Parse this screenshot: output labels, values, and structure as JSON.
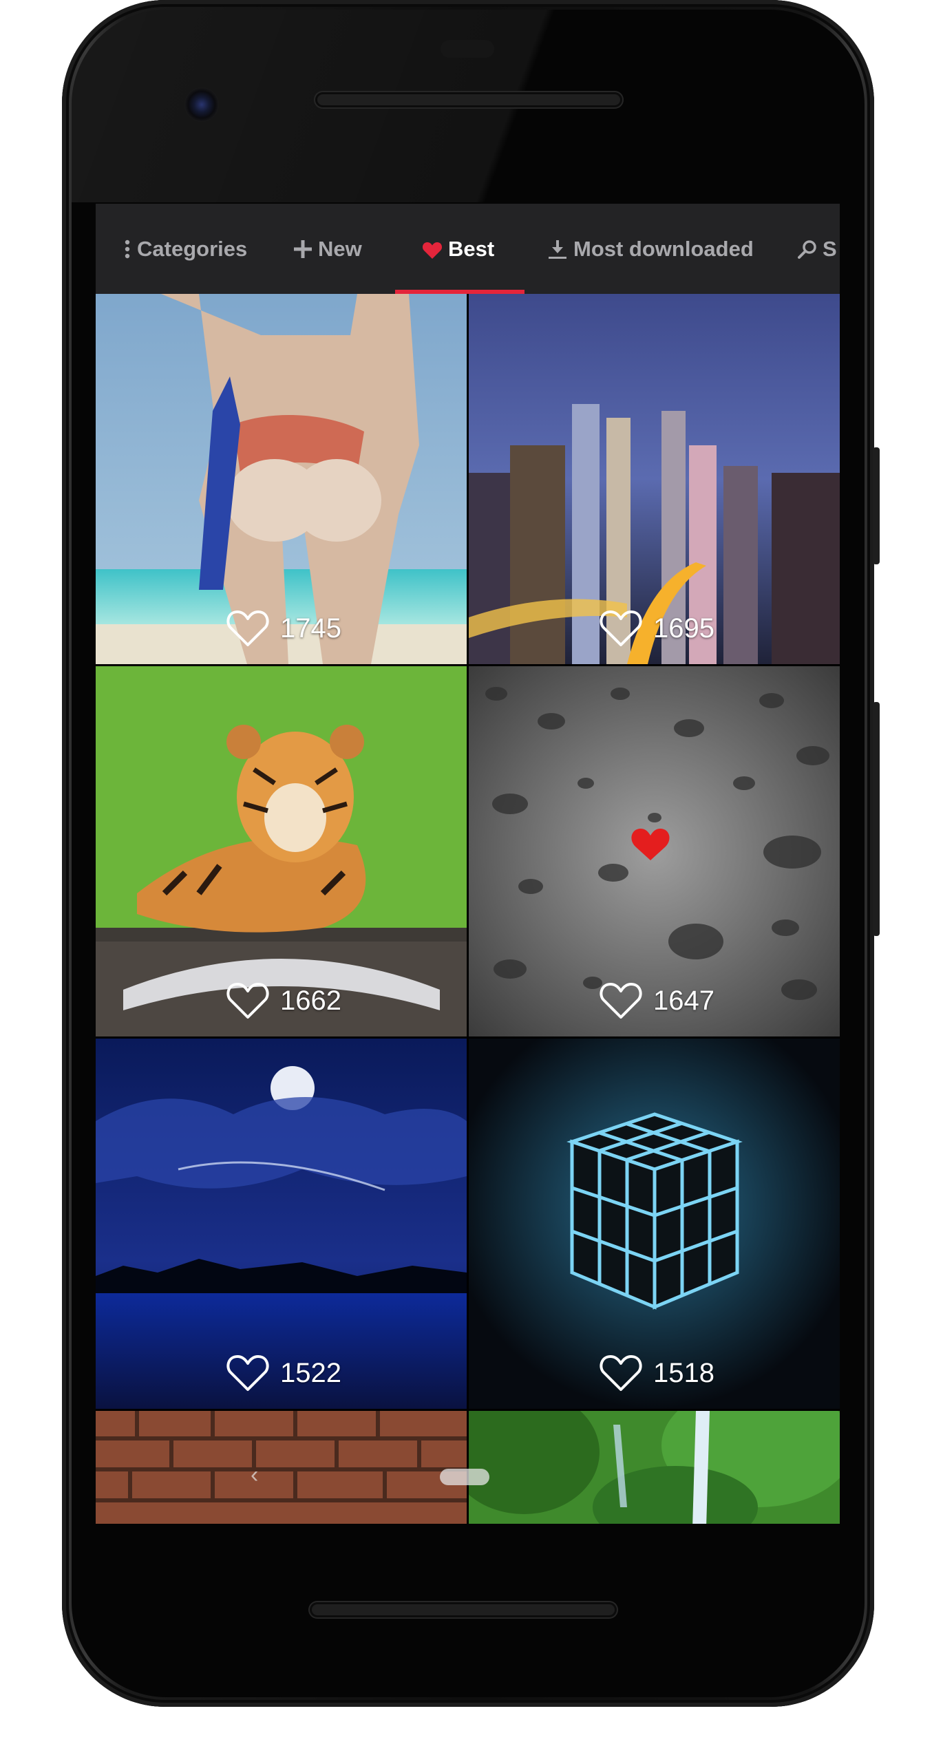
{
  "tabs": [
    {
      "label": "Categories",
      "icon": "vertical-dots-icon",
      "active": false
    },
    {
      "label": "New",
      "icon": "plus-icon",
      "active": false
    },
    {
      "label": "Best",
      "icon": "heart-icon",
      "active": true
    },
    {
      "label": "Most downloaded",
      "icon": "download-icon",
      "active": false
    },
    {
      "label": "S",
      "icon": "search-icon",
      "active": false
    }
  ],
  "colors": {
    "accent": "#e4253b",
    "tabbar_bg": "#232325",
    "inactive_text": "#a9a9ad"
  },
  "wallpapers": [
    {
      "subject": "beach-bikini",
      "likes": "1745"
    },
    {
      "subject": "city-night",
      "likes": "1695"
    },
    {
      "subject": "tiger-book",
      "likes": "1662"
    },
    {
      "subject": "water-drops-heart",
      "likes": "1647"
    },
    {
      "subject": "moon-night-lake",
      "likes": "1522"
    },
    {
      "subject": "glowing-cube",
      "likes": "1518"
    },
    {
      "subject": "brick-wall",
      "likes": ""
    },
    {
      "subject": "waterfall-forest",
      "likes": ""
    }
  ]
}
